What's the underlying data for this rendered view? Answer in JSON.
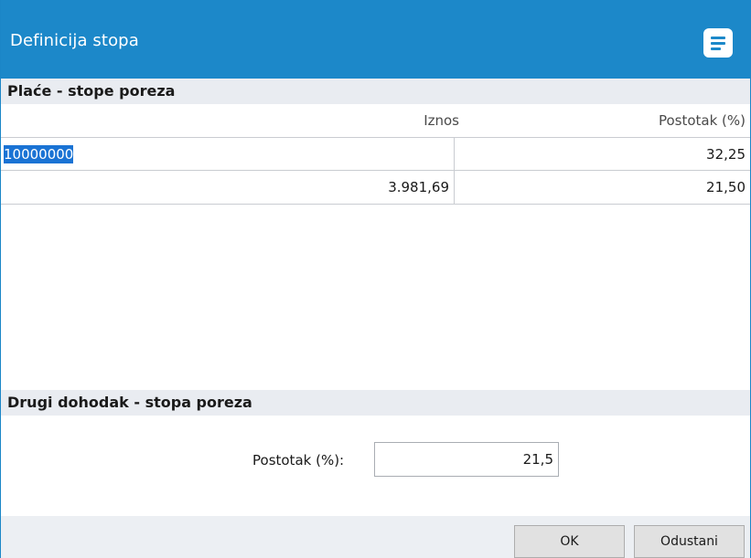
{
  "window": {
    "title": "Definicija stopa",
    "menu_icon": "menu-document-icon"
  },
  "salary_section": {
    "header": "Plaće - stope poreza",
    "columns": {
      "amount": "Iznos",
      "percent": "Postotak (%)"
    },
    "rows": [
      {
        "amount": "10000000",
        "percent": "32,25"
      },
      {
        "amount": "3.981,69",
        "percent": "21,50"
      }
    ]
  },
  "other_income_section": {
    "header": "Drugi dohodak - stopa poreza",
    "percent_label": "Postotak (%):",
    "percent_value": "21,5"
  },
  "buttons": {
    "ok": "OK",
    "cancel": "Odustani"
  },
  "colors": {
    "titlebar": "#1c88c9",
    "selection": "#1a73d4"
  }
}
